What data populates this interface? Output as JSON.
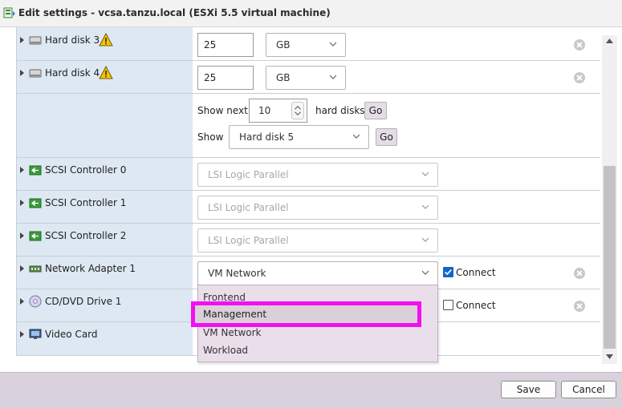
{
  "window": {
    "title": "Edit settings - vcsa.tanzu.local (ESXi 5.5 virtual machine)"
  },
  "devices": [
    {
      "label": "Hard disk 3",
      "size": "25",
      "unit": "GB"
    },
    {
      "label": "Hard disk 4",
      "size": "25",
      "unit": "GB"
    },
    {
      "label": "SCSI Controller 0",
      "value": "LSI Logic Parallel"
    },
    {
      "label": "SCSI Controller 1",
      "value": "LSI Logic Parallel"
    },
    {
      "label": "SCSI Controller 2",
      "value": "LSI Logic Parallel"
    },
    {
      "label": "Network Adapter 1",
      "value": "VM Network",
      "connect_label": "Connect",
      "connected": true
    },
    {
      "label": "CD/DVD Drive 1",
      "connect_label": "Connect",
      "connected": false
    },
    {
      "label": "Video Card"
    }
  ],
  "paging": {
    "show_next_label": "Show next",
    "show_next_value": "10",
    "hard_disks_label": "hard disks",
    "go_label": "Go",
    "show_label": "Show",
    "show_value": "Hard disk 5"
  },
  "network_dropdown": {
    "options": [
      "Frontend",
      "Management",
      "VM Network",
      "Workload"
    ],
    "highlighted": "Management"
  },
  "footer": {
    "save_label": "Save",
    "cancel_label": "Cancel"
  },
  "colors": {
    "accent_highlight": "#f20ff2",
    "checkbox_on": "#1366c8",
    "left_column": "#dde8f3"
  }
}
